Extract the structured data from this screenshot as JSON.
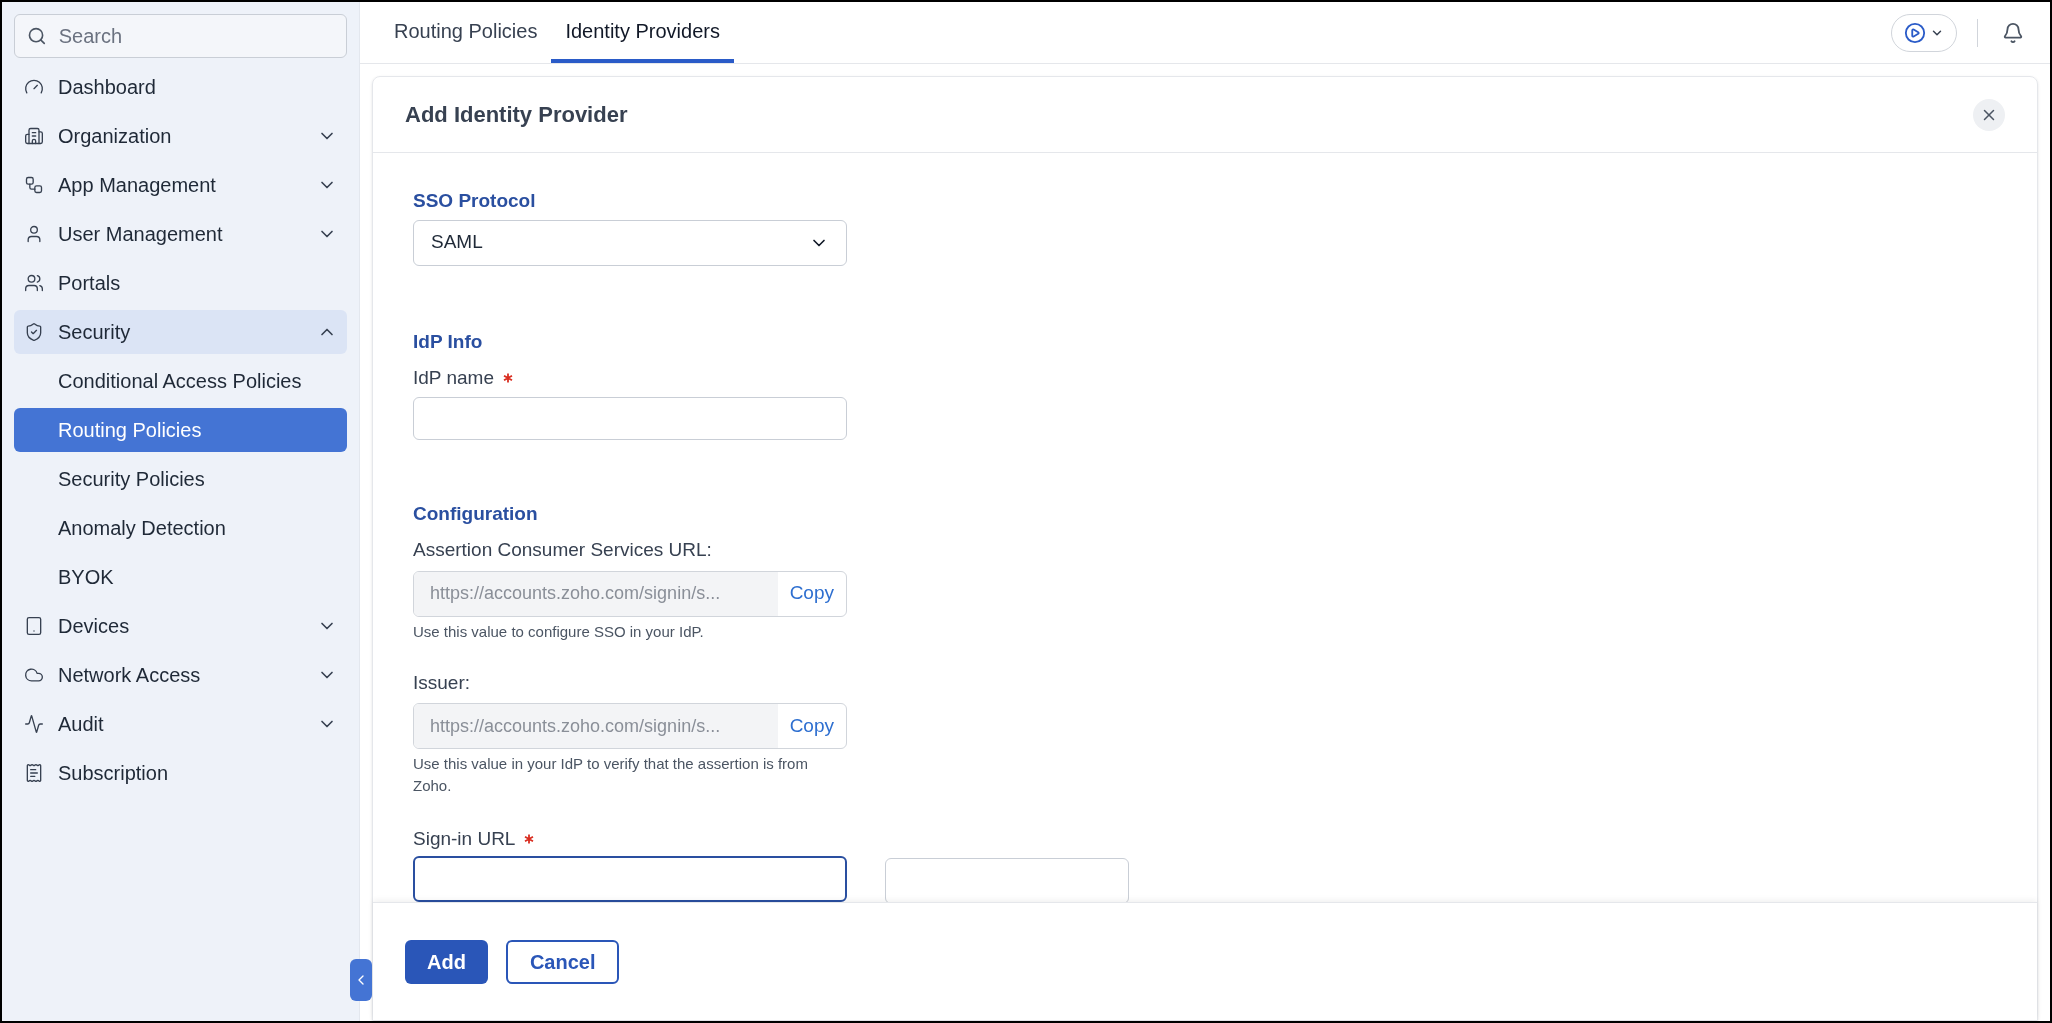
{
  "sidebar": {
    "search": {
      "placeholder": "Search"
    },
    "items": [
      {
        "kind": "link",
        "label": "Dashboard",
        "selected": false
      },
      {
        "kind": "group",
        "label": "Organization",
        "expanded": false,
        "selected": false
      },
      {
        "kind": "group",
        "label": "App Management",
        "expanded": false,
        "selected": false
      },
      {
        "kind": "group",
        "label": "User Management",
        "expanded": false,
        "selected": false
      },
      {
        "kind": "link",
        "label": "Portals",
        "selected": false
      },
      {
        "kind": "group",
        "label": "Security",
        "expanded": true,
        "selected": true,
        "children": [
          {
            "label": "Conditional Access Policies",
            "selected": false
          },
          {
            "label": "Routing Policies",
            "selected": true
          },
          {
            "label": "Security Policies",
            "selected": false
          },
          {
            "label": "Anomaly Detection",
            "selected": false
          },
          {
            "label": "BYOK",
            "selected": false
          }
        ]
      },
      {
        "kind": "group",
        "label": "Devices",
        "expanded": false,
        "selected": false
      },
      {
        "kind": "group",
        "label": "Network Access",
        "expanded": false,
        "selected": false
      },
      {
        "kind": "group",
        "label": "Audit",
        "expanded": false,
        "selected": false
      },
      {
        "kind": "link",
        "label": "Subscription",
        "selected": false
      }
    ]
  },
  "tabs": [
    {
      "label": "Routing Policies",
      "selected": false
    },
    {
      "label": "Identity Providers",
      "selected": true
    }
  ],
  "panel": {
    "title": "Add Identity Provider",
    "sso_protocol": {
      "heading": "SSO Protocol",
      "value": "SAML"
    },
    "idp_info": {
      "heading": "IdP Info",
      "label": "IdP name",
      "required": true
    },
    "configuration": {
      "heading": "Configuration",
      "copy_fields": [
        {
          "label": "Assertion Consumer Services URL:",
          "value": "https://accounts.zoho.com/signin/s...",
          "button": "Copy",
          "hint": "Use this value to configure SSO in your IdP."
        },
        {
          "label": "Issuer:",
          "value": "https://accounts.zoho.com/signin/s...",
          "button": "Copy",
          "hint": "Use this value in your IdP to verify that the assertion is from Zoho."
        }
      ],
      "sign_in_url": {
        "label": "Sign-in URL",
        "required": true,
        "focused": true
      }
    },
    "buttons": [
      {
        "label": "Add",
        "kind": "primary"
      },
      {
        "label": "Cancel",
        "kind": "secondary"
      }
    ]
  }
}
